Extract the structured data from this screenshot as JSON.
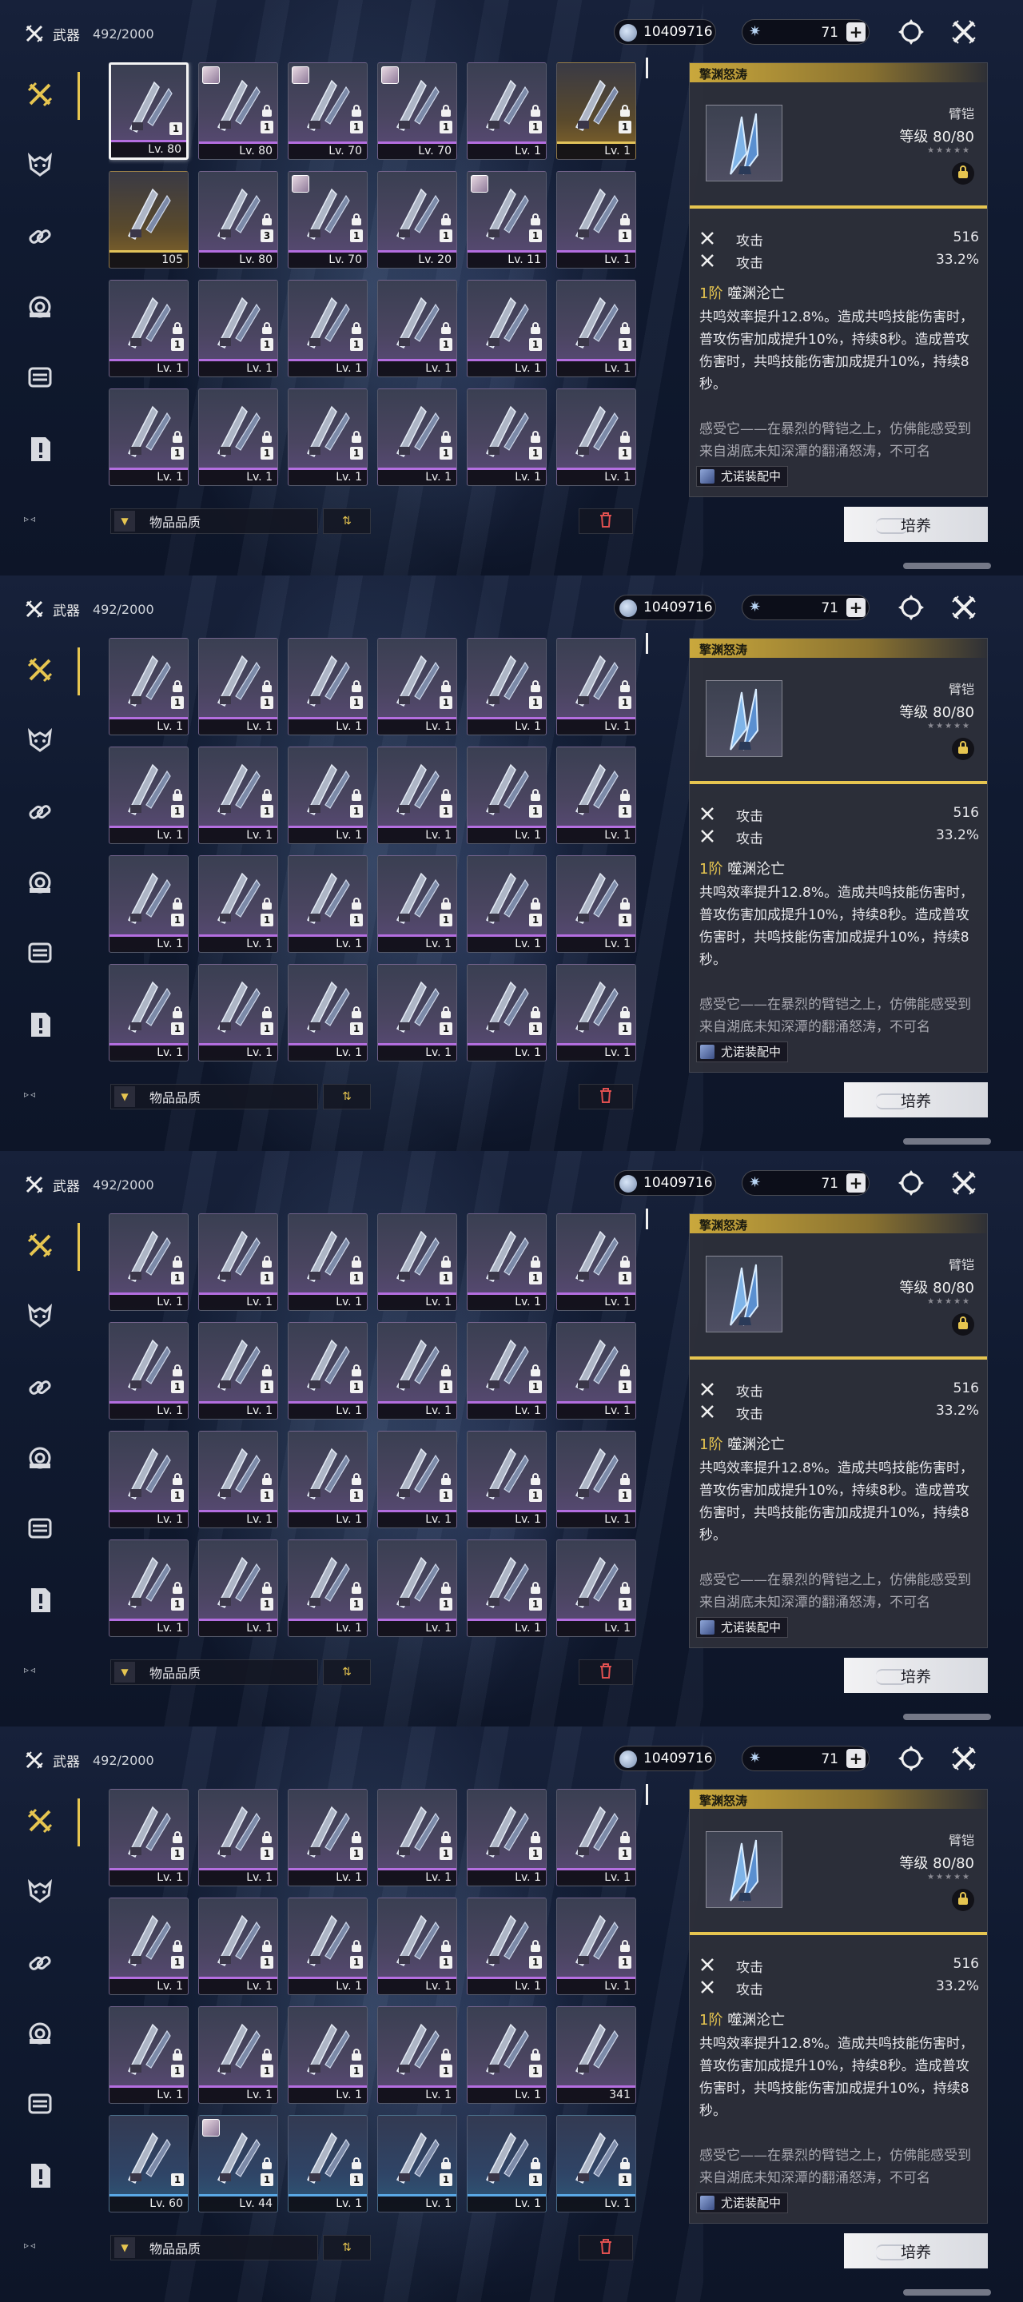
{
  "header": {
    "title": "武器",
    "count": "492/2000"
  },
  "currency": {
    "shell_credit": "10409716",
    "astrite": "71",
    "plus": "+"
  },
  "colors": {
    "accent_gold": "#e6c550",
    "purple_rarity": "#b46ee0",
    "gold_rarity": "#e2c25a",
    "blue_rarity": "#5aa8e6"
  },
  "sidebar": {
    "items": [
      {
        "icon": "swords-icon",
        "active": true
      },
      {
        "icon": "echo-mask-icon",
        "active": false
      },
      {
        "icon": "chain-link-icon",
        "active": false
      },
      {
        "icon": "device-icon",
        "active": false
      },
      {
        "icon": "chip-icon",
        "active": false
      },
      {
        "icon": "document-alert-icon",
        "active": false
      }
    ],
    "arrows": "▹◃"
  },
  "filter": {
    "label": "物品品质",
    "sort_icon": "⇅"
  },
  "detail": {
    "name": "擎渊怒涛",
    "type": "臂铠",
    "level": "等级 80/80",
    "stars": "★★★★★",
    "stats": [
      {
        "label": "攻击",
        "value": "516"
      },
      {
        "label": "攻击",
        "value": "33.2%"
      }
    ],
    "skill_rank": "1阶",
    "skill_name": "噬渊沦亡",
    "skill_desc": "共鸣效率提升12.8%。造成共鸣技能伤害时，普攻伤害加成提升10%，持续8秒。造成普攻伤害时，共鸣技能伤害加成提升10%，持续8秒。",
    "lore": "感受它——在暴烈的臂铠之上，仿佛能感受到来自湖底未知深潭的翻涌怒涛，不可名",
    "equipped": "尤诺装配中",
    "upgrade_label": "培养"
  },
  "panels": [
    {
      "rows": [
        [
          {
            "r": "purple",
            "lv": "Lv. 80",
            "rank": "1",
            "lock": false,
            "sel": true,
            "portrait": false
          },
          {
            "r": "purple",
            "lv": "Lv. 80",
            "rank": "1",
            "lock": true,
            "sel": false,
            "portrait": true
          },
          {
            "r": "purple",
            "lv": "Lv. 70",
            "rank": "1",
            "lock": true,
            "sel": false,
            "portrait": true
          },
          {
            "r": "purple",
            "lv": "Lv. 70",
            "rank": "1",
            "lock": true,
            "sel": false,
            "portrait": true
          },
          {
            "r": "purple",
            "lv": "Lv. 1",
            "rank": "1",
            "lock": true,
            "sel": false,
            "portrait": false
          },
          {
            "r": "gold",
            "lv": "Lv. 1",
            "rank": "1",
            "lock": true,
            "sel": false,
            "portrait": false
          }
        ],
        [
          {
            "r": "gold",
            "lv": "105",
            "rank": "",
            "lock": false,
            "sel": false,
            "portrait": false
          },
          {
            "r": "purple",
            "lv": "Lv. 80",
            "rank": "3",
            "lock": true,
            "sel": false,
            "portrait": false
          },
          {
            "r": "purple",
            "lv": "Lv. 70",
            "rank": "1",
            "lock": true,
            "sel": false,
            "portrait": true
          },
          {
            "r": "purple",
            "lv": "Lv. 20",
            "rank": "1",
            "lock": true,
            "sel": false,
            "portrait": false
          },
          {
            "r": "purple",
            "lv": "Lv. 11",
            "rank": "1",
            "lock": true,
            "sel": false,
            "portrait": true
          },
          {
            "r": "purple",
            "lv": "Lv. 1",
            "rank": "1",
            "lock": true,
            "sel": false,
            "portrait": false
          }
        ],
        [
          {
            "r": "purple",
            "lv": "Lv. 1",
            "rank": "1",
            "lock": true,
            "sel": false,
            "portrait": false
          },
          {
            "r": "purple",
            "lv": "Lv. 1",
            "rank": "1",
            "lock": true,
            "sel": false,
            "portrait": false
          },
          {
            "r": "purple",
            "lv": "Lv. 1",
            "rank": "1",
            "lock": true,
            "sel": false,
            "portrait": false
          },
          {
            "r": "purple",
            "lv": "Lv. 1",
            "rank": "1",
            "lock": true,
            "sel": false,
            "portrait": false
          },
          {
            "r": "purple",
            "lv": "Lv. 1",
            "rank": "1",
            "lock": true,
            "sel": false,
            "portrait": false
          },
          {
            "r": "purple",
            "lv": "Lv. 1",
            "rank": "1",
            "lock": true,
            "sel": false,
            "portrait": false
          }
        ],
        [
          {
            "r": "purple",
            "lv": "Lv. 1",
            "rank": "1",
            "lock": true,
            "sel": false,
            "portrait": false
          },
          {
            "r": "purple",
            "lv": "Lv. 1",
            "rank": "1",
            "lock": true,
            "sel": false,
            "portrait": false
          },
          {
            "r": "purple",
            "lv": "Lv. 1",
            "rank": "1",
            "lock": true,
            "sel": false,
            "portrait": false
          },
          {
            "r": "purple",
            "lv": "Lv. 1",
            "rank": "1",
            "lock": true,
            "sel": false,
            "portrait": false
          },
          {
            "r": "purple",
            "lv": "Lv. 1",
            "rank": "1",
            "lock": true,
            "sel": false,
            "portrait": false
          },
          {
            "r": "purple",
            "lv": "Lv. 1",
            "rank": "1",
            "lock": true,
            "sel": false,
            "portrait": false
          }
        ]
      ]
    },
    {
      "rows": [
        [
          {
            "r": "purple",
            "lv": "Lv. 1",
            "rank": "1",
            "lock": true,
            "sel": false,
            "portrait": false
          },
          {
            "r": "purple",
            "lv": "Lv. 1",
            "rank": "1",
            "lock": true,
            "sel": false,
            "portrait": false
          },
          {
            "r": "purple",
            "lv": "Lv. 1",
            "rank": "1",
            "lock": true,
            "sel": false,
            "portrait": false
          },
          {
            "r": "purple",
            "lv": "Lv. 1",
            "rank": "1",
            "lock": true,
            "sel": false,
            "portrait": false
          },
          {
            "r": "purple",
            "lv": "Lv. 1",
            "rank": "1",
            "lock": true,
            "sel": false,
            "portrait": false
          },
          {
            "r": "purple",
            "lv": "Lv. 1",
            "rank": "1",
            "lock": true,
            "sel": false,
            "portrait": false
          }
        ],
        [
          {
            "r": "purple",
            "lv": "Lv. 1",
            "rank": "1",
            "lock": true,
            "sel": false,
            "portrait": false
          },
          {
            "r": "purple",
            "lv": "Lv. 1",
            "rank": "1",
            "lock": true,
            "sel": false,
            "portrait": false
          },
          {
            "r": "purple",
            "lv": "Lv. 1",
            "rank": "1",
            "lock": true,
            "sel": false,
            "portrait": false
          },
          {
            "r": "purple",
            "lv": "Lv. 1",
            "rank": "1",
            "lock": true,
            "sel": false,
            "portrait": false
          },
          {
            "r": "purple",
            "lv": "Lv. 1",
            "rank": "1",
            "lock": true,
            "sel": false,
            "portrait": false
          },
          {
            "r": "purple",
            "lv": "Lv. 1",
            "rank": "1",
            "lock": true,
            "sel": false,
            "portrait": false
          }
        ],
        [
          {
            "r": "purple",
            "lv": "Lv. 1",
            "rank": "1",
            "lock": true,
            "sel": false,
            "portrait": false
          },
          {
            "r": "purple",
            "lv": "Lv. 1",
            "rank": "1",
            "lock": true,
            "sel": false,
            "portrait": false
          },
          {
            "r": "purple",
            "lv": "Lv. 1",
            "rank": "1",
            "lock": true,
            "sel": false,
            "portrait": false
          },
          {
            "r": "purple",
            "lv": "Lv. 1",
            "rank": "1",
            "lock": true,
            "sel": false,
            "portrait": false
          },
          {
            "r": "purple",
            "lv": "Lv. 1",
            "rank": "1",
            "lock": true,
            "sel": false,
            "portrait": false
          },
          {
            "r": "purple",
            "lv": "Lv. 1",
            "rank": "1",
            "lock": true,
            "sel": false,
            "portrait": false
          }
        ],
        [
          {
            "r": "purple",
            "lv": "Lv. 1",
            "rank": "1",
            "lock": true,
            "sel": false,
            "portrait": false
          },
          {
            "r": "purple",
            "lv": "Lv. 1",
            "rank": "1",
            "lock": true,
            "sel": false,
            "portrait": false
          },
          {
            "r": "purple",
            "lv": "Lv. 1",
            "rank": "1",
            "lock": true,
            "sel": false,
            "portrait": false
          },
          {
            "r": "purple",
            "lv": "Lv. 1",
            "rank": "1",
            "lock": true,
            "sel": false,
            "portrait": false
          },
          {
            "r": "purple",
            "lv": "Lv. 1",
            "rank": "1",
            "lock": true,
            "sel": false,
            "portrait": false
          },
          {
            "r": "purple",
            "lv": "Lv. 1",
            "rank": "1",
            "lock": true,
            "sel": false,
            "portrait": false
          }
        ]
      ]
    },
    {
      "rows": [
        [
          {
            "r": "purple",
            "lv": "Lv. 1",
            "rank": "1",
            "lock": true,
            "sel": false,
            "portrait": false
          },
          {
            "r": "purple",
            "lv": "Lv. 1",
            "rank": "1",
            "lock": true,
            "sel": false,
            "portrait": false
          },
          {
            "r": "purple",
            "lv": "Lv. 1",
            "rank": "1",
            "lock": true,
            "sel": false,
            "portrait": false
          },
          {
            "r": "purple",
            "lv": "Lv. 1",
            "rank": "1",
            "lock": true,
            "sel": false,
            "portrait": false
          },
          {
            "r": "purple",
            "lv": "Lv. 1",
            "rank": "1",
            "lock": true,
            "sel": false,
            "portrait": false
          },
          {
            "r": "purple",
            "lv": "Lv. 1",
            "rank": "1",
            "lock": true,
            "sel": false,
            "portrait": false
          }
        ],
        [
          {
            "r": "purple",
            "lv": "Lv. 1",
            "rank": "1",
            "lock": true,
            "sel": false,
            "portrait": false
          },
          {
            "r": "purple",
            "lv": "Lv. 1",
            "rank": "1",
            "lock": true,
            "sel": false,
            "portrait": false
          },
          {
            "r": "purple",
            "lv": "Lv. 1",
            "rank": "1",
            "lock": true,
            "sel": false,
            "portrait": false
          },
          {
            "r": "purple",
            "lv": "Lv. 1",
            "rank": "1",
            "lock": true,
            "sel": false,
            "portrait": false
          },
          {
            "r": "purple",
            "lv": "Lv. 1",
            "rank": "1",
            "lock": true,
            "sel": false,
            "portrait": false
          },
          {
            "r": "purple",
            "lv": "Lv. 1",
            "rank": "1",
            "lock": true,
            "sel": false,
            "portrait": false
          }
        ],
        [
          {
            "r": "purple",
            "lv": "Lv. 1",
            "rank": "1",
            "lock": true,
            "sel": false,
            "portrait": false
          },
          {
            "r": "purple",
            "lv": "Lv. 1",
            "rank": "1",
            "lock": true,
            "sel": false,
            "portrait": false
          },
          {
            "r": "purple",
            "lv": "Lv. 1",
            "rank": "1",
            "lock": true,
            "sel": false,
            "portrait": false
          },
          {
            "r": "purple",
            "lv": "Lv. 1",
            "rank": "1",
            "lock": true,
            "sel": false,
            "portrait": false
          },
          {
            "r": "purple",
            "lv": "Lv. 1",
            "rank": "1",
            "lock": true,
            "sel": false,
            "portrait": false
          },
          {
            "r": "purple",
            "lv": "Lv. 1",
            "rank": "1",
            "lock": true,
            "sel": false,
            "portrait": false
          }
        ],
        [
          {
            "r": "purple",
            "lv": "Lv. 1",
            "rank": "1",
            "lock": true,
            "sel": false,
            "portrait": false
          },
          {
            "r": "purple",
            "lv": "Lv. 1",
            "rank": "1",
            "lock": true,
            "sel": false,
            "portrait": false
          },
          {
            "r": "purple",
            "lv": "Lv. 1",
            "rank": "1",
            "lock": true,
            "sel": false,
            "portrait": false
          },
          {
            "r": "purple",
            "lv": "Lv. 1",
            "rank": "1",
            "lock": true,
            "sel": false,
            "portrait": false
          },
          {
            "r": "purple",
            "lv": "Lv. 1",
            "rank": "1",
            "lock": true,
            "sel": false,
            "portrait": false
          },
          {
            "r": "purple",
            "lv": "Lv. 1",
            "rank": "1",
            "lock": true,
            "sel": false,
            "portrait": false
          }
        ]
      ]
    },
    {
      "rows": [
        [
          {
            "r": "purple",
            "lv": "Lv. 1",
            "rank": "1",
            "lock": true,
            "sel": false,
            "portrait": false
          },
          {
            "r": "purple",
            "lv": "Lv. 1",
            "rank": "1",
            "lock": true,
            "sel": false,
            "portrait": false
          },
          {
            "r": "purple",
            "lv": "Lv. 1",
            "rank": "1",
            "lock": true,
            "sel": false,
            "portrait": false
          },
          {
            "r": "purple",
            "lv": "Lv. 1",
            "rank": "1",
            "lock": true,
            "sel": false,
            "portrait": false
          },
          {
            "r": "purple",
            "lv": "Lv. 1",
            "rank": "1",
            "lock": true,
            "sel": false,
            "portrait": false
          },
          {
            "r": "purple",
            "lv": "Lv. 1",
            "rank": "1",
            "lock": true,
            "sel": false,
            "portrait": false
          }
        ],
        [
          {
            "r": "purple",
            "lv": "Lv. 1",
            "rank": "1",
            "lock": true,
            "sel": false,
            "portrait": false
          },
          {
            "r": "purple",
            "lv": "Lv. 1",
            "rank": "1",
            "lock": true,
            "sel": false,
            "portrait": false
          },
          {
            "r": "purple",
            "lv": "Lv. 1",
            "rank": "1",
            "lock": true,
            "sel": false,
            "portrait": false
          },
          {
            "r": "purple",
            "lv": "Lv. 1",
            "rank": "1",
            "lock": true,
            "sel": false,
            "portrait": false
          },
          {
            "r": "purple",
            "lv": "Lv. 1",
            "rank": "1",
            "lock": true,
            "sel": false,
            "portrait": false
          },
          {
            "r": "purple",
            "lv": "Lv. 1",
            "rank": "1",
            "lock": true,
            "sel": false,
            "portrait": false
          }
        ],
        [
          {
            "r": "purple",
            "lv": "Lv. 1",
            "rank": "1",
            "lock": true,
            "sel": false,
            "portrait": false
          },
          {
            "r": "purple",
            "lv": "Lv. 1",
            "rank": "1",
            "lock": true,
            "sel": false,
            "portrait": false
          },
          {
            "r": "purple",
            "lv": "Lv. 1",
            "rank": "1",
            "lock": true,
            "sel": false,
            "portrait": false
          },
          {
            "r": "purple",
            "lv": "Lv. 1",
            "rank": "1",
            "lock": true,
            "sel": false,
            "portrait": false
          },
          {
            "r": "purple",
            "lv": "Lv. 1",
            "rank": "1",
            "lock": true,
            "sel": false,
            "portrait": false
          },
          {
            "r": "purple",
            "lv": "341",
            "rank": "",
            "lock": false,
            "sel": false,
            "portrait": false
          }
        ],
        [
          {
            "r": "blue",
            "lv": "Lv. 60",
            "rank": "1",
            "lock": false,
            "sel": false,
            "portrait": false
          },
          {
            "r": "blue",
            "lv": "Lv. 44",
            "rank": "1",
            "lock": true,
            "sel": false,
            "portrait": true
          },
          {
            "r": "blue",
            "lv": "Lv. 1",
            "rank": "1",
            "lock": true,
            "sel": false,
            "portrait": false
          },
          {
            "r": "blue",
            "lv": "Lv. 1",
            "rank": "1",
            "lock": true,
            "sel": false,
            "portrait": false
          },
          {
            "r": "blue",
            "lv": "Lv. 1",
            "rank": "1",
            "lock": true,
            "sel": false,
            "portrait": false
          },
          {
            "r": "blue",
            "lv": "Lv. 1",
            "rank": "1",
            "lock": true,
            "sel": false,
            "portrait": false
          }
        ]
      ]
    }
  ]
}
